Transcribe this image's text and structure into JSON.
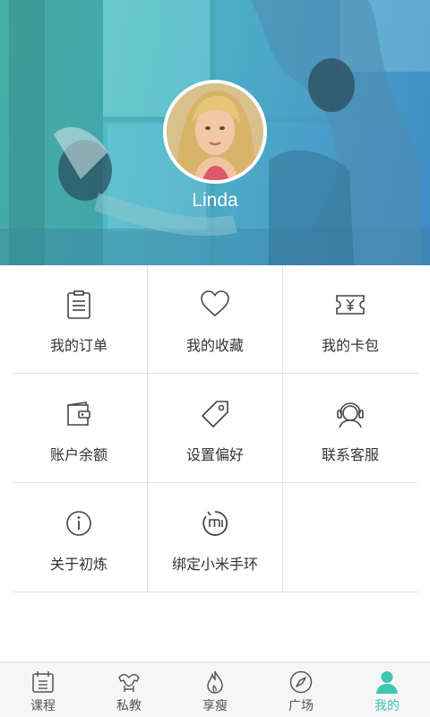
{
  "profile": {
    "name": "Linda"
  },
  "menu": {
    "items": [
      {
        "label": "我的订单",
        "icon": "order-list-icon"
      },
      {
        "label": "我的收藏",
        "icon": "heart-icon"
      },
      {
        "label": "我的卡包",
        "icon": "ticket-yen-icon"
      },
      {
        "label": "账户余额",
        "icon": "wallet-icon"
      },
      {
        "label": "设置偏好",
        "icon": "tag-icon"
      },
      {
        "label": "联系客服",
        "icon": "headset-icon"
      },
      {
        "label": "关于初炼",
        "icon": "info-icon"
      },
      {
        "label": "绑定小米手环",
        "icon": "mi-band-icon"
      }
    ]
  },
  "tabbar": {
    "tabs": [
      {
        "label": "课程",
        "icon": "calendar-icon",
        "active": false
      },
      {
        "label": "私教",
        "icon": "muscle-icon",
        "active": false
      },
      {
        "label": "享瘦",
        "icon": "flame-icon",
        "active": false
      },
      {
        "label": "广场",
        "icon": "compass-icon",
        "active": false
      },
      {
        "label": "我的",
        "icon": "person-icon",
        "active": true
      }
    ]
  },
  "colors": {
    "accent": "#3cc7b4",
    "header_gradient_start": "#5ec8c0",
    "header_gradient_end": "#3f8cc6",
    "text": "#333333",
    "divider": "#e3e3e3"
  }
}
